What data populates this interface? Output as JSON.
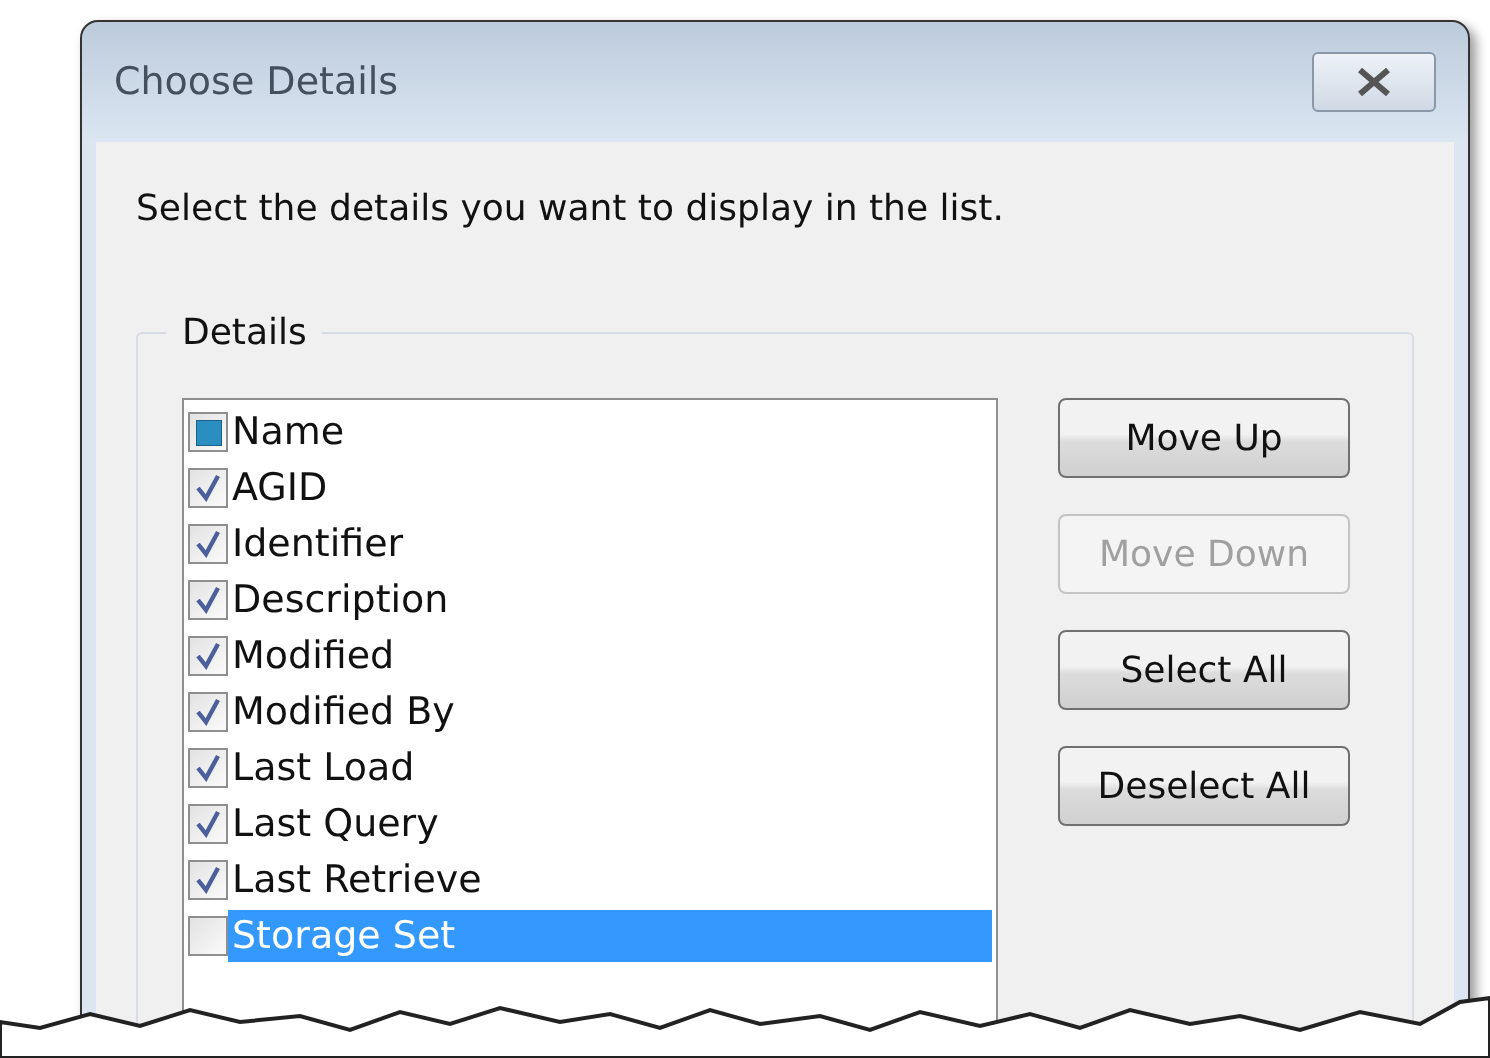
{
  "window": {
    "title": "Choose Details"
  },
  "instruction": "Select the details you want to display in the list.",
  "group": {
    "label": "Details"
  },
  "details": [
    {
      "label": "Name",
      "checked": false,
      "indeterminate": true,
      "selected": false
    },
    {
      "label": "AGID",
      "checked": true,
      "indeterminate": false,
      "selected": false
    },
    {
      "label": "Identifier",
      "checked": true,
      "indeterminate": false,
      "selected": false
    },
    {
      "label": "Description",
      "checked": true,
      "indeterminate": false,
      "selected": false
    },
    {
      "label": "Modified",
      "checked": true,
      "indeterminate": false,
      "selected": false
    },
    {
      "label": "Modified By",
      "checked": true,
      "indeterminate": false,
      "selected": false
    },
    {
      "label": "Last Load",
      "checked": true,
      "indeterminate": false,
      "selected": false
    },
    {
      "label": "Last Query",
      "checked": true,
      "indeterminate": false,
      "selected": false
    },
    {
      "label": "Last Retrieve",
      "checked": true,
      "indeterminate": false,
      "selected": false
    },
    {
      "label": "Storage Set",
      "checked": false,
      "indeterminate": false,
      "selected": true
    }
  ],
  "buttons": [
    {
      "label": "Move Up",
      "disabled": false
    },
    {
      "label": "Move Down",
      "disabled": true
    },
    {
      "label": "Select All",
      "disabled": false
    },
    {
      "label": "Deselect All",
      "disabled": false
    }
  ]
}
